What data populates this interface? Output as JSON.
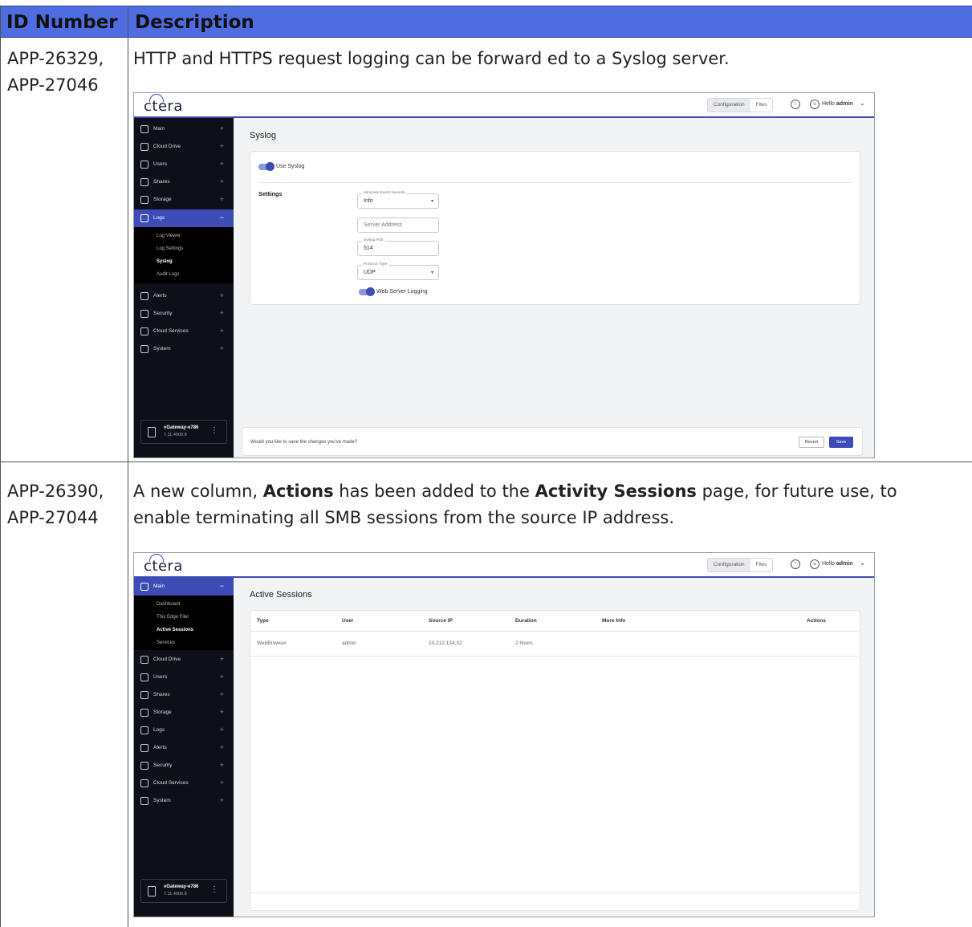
{
  "table": {
    "headers": {
      "id": "ID Number",
      "description": "Description"
    },
    "rows": [
      {
        "id_line1": "APP-26329,",
        "id_line2": "APP-27046",
        "desc_line1": "HTTP and HTTPS request logging can be forward ed to a Syslog server."
      },
      {
        "id_line1": "APP-26390,",
        "id_line2": "APP-27044",
        "desc_pre": "A new column, ",
        "desc_bold1": "Actions",
        "desc_mid": " has been added to the ",
        "desc_bold2": "Activity Sessions",
        "desc_post1": " page, for future use, to",
        "desc_line2": "enable terminating all SMB sessions from the source IP address."
      }
    ]
  },
  "app_common": {
    "logo": "ctera",
    "seg_configuration": "Configuration",
    "seg_files": "Files",
    "hello_prefix": "Hello",
    "hello_user": "admin",
    "device_name": "vGateway-e786",
    "device_version": "7.11.4900.8",
    "colors": {
      "accent": "#3c4bb5",
      "header_blue": "#4f6de0",
      "sidebar_bg": "#0e1018"
    }
  },
  "shot1": {
    "nav": [
      {
        "label": "Main",
        "icon": "grid-icon",
        "sign": "+"
      },
      {
        "label": "Cloud Drive",
        "icon": "cloud-drive-icon",
        "sign": "+"
      },
      {
        "label": "Users",
        "icon": "users-icon",
        "sign": "+"
      },
      {
        "label": "Shares",
        "icon": "share-icon",
        "sign": "+"
      },
      {
        "label": "Storage",
        "icon": "storage-icon",
        "sign": "+"
      },
      {
        "label": "Logs",
        "icon": "logs-icon",
        "sign": "−"
      }
    ],
    "subnav": [
      "Log Viewer",
      "Log Settings",
      "Syslog",
      "Audit Logs"
    ],
    "nav_after": [
      {
        "label": "Alerts",
        "icon": "bell-icon",
        "sign": "+"
      },
      {
        "label": "Security",
        "icon": "shield-icon",
        "sign": "+"
      },
      {
        "label": "Cloud Services",
        "icon": "cloud-icon",
        "sign": "+"
      },
      {
        "label": "System",
        "icon": "system-icon",
        "sign": "+"
      }
    ],
    "page_title": "Syslog",
    "use_syslog": "Use Syslog",
    "settings_label": "Settings",
    "min_severity_legend": "Minimum Event Severity",
    "min_severity_value": "Info",
    "server_address_placeholder": "Server Address",
    "syslog_port_legend": "Syslog Port",
    "syslog_port_value": "514",
    "protocol_legend": "Protocol Type",
    "protocol_value": "UDP",
    "web_server_logging": "Web Server Logging",
    "save_question": "Would you like to save the changes you've made?",
    "revert": "Revert",
    "save": "Save"
  },
  "shot2": {
    "nav_main": {
      "label": "Main",
      "icon": "grid-icon",
      "sign": "−"
    },
    "subnav": [
      "Dashboard",
      "This Edge Filer",
      "Active Sessions",
      "Services"
    ],
    "nav_after": [
      {
        "label": "Cloud Drive",
        "icon": "cloud-drive-icon",
        "sign": "+"
      },
      {
        "label": "Users",
        "icon": "users-icon",
        "sign": "+"
      },
      {
        "label": "Shares",
        "icon": "share-icon",
        "sign": "+"
      },
      {
        "label": "Storage",
        "icon": "storage-icon",
        "sign": "+"
      },
      {
        "label": "Logs",
        "icon": "logs-icon",
        "sign": "+"
      },
      {
        "label": "Alerts",
        "icon": "bell-icon",
        "sign": "+"
      },
      {
        "label": "Security",
        "icon": "shield-icon",
        "sign": "+"
      },
      {
        "label": "Cloud Services",
        "icon": "cloud-icon",
        "sign": "+"
      },
      {
        "label": "System",
        "icon": "system-icon",
        "sign": "+"
      }
    ],
    "page_title": "Active Sessions",
    "columns": [
      "Type",
      "User",
      "Source IP",
      "Duration",
      "More Info",
      "Actions"
    ],
    "row": [
      "WebBrowser",
      "admin",
      "10.212.134.32",
      "2 hours",
      "",
      ""
    ]
  }
}
